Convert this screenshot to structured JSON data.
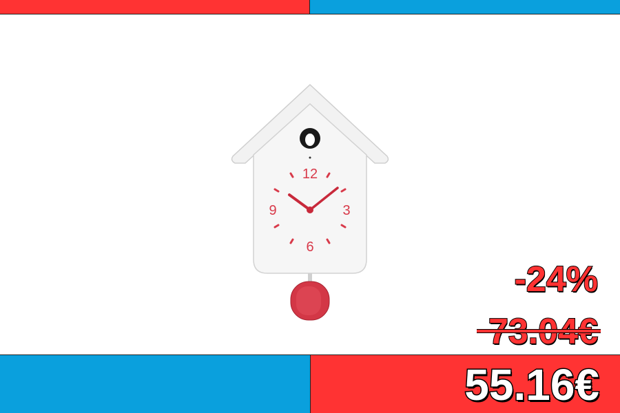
{
  "colors": {
    "red": "#ff3333",
    "blue": "#0aa0dd",
    "clock_white": "#f4f4f4",
    "clock_red": "#d83a4a"
  },
  "product": {
    "image_icon": "cuckoo-clock",
    "dial_numbers": [
      "12",
      "3",
      "6",
      "9"
    ]
  },
  "pricing": {
    "discount": "-24%",
    "old_price": "73.04€",
    "new_price": "55.16€"
  }
}
